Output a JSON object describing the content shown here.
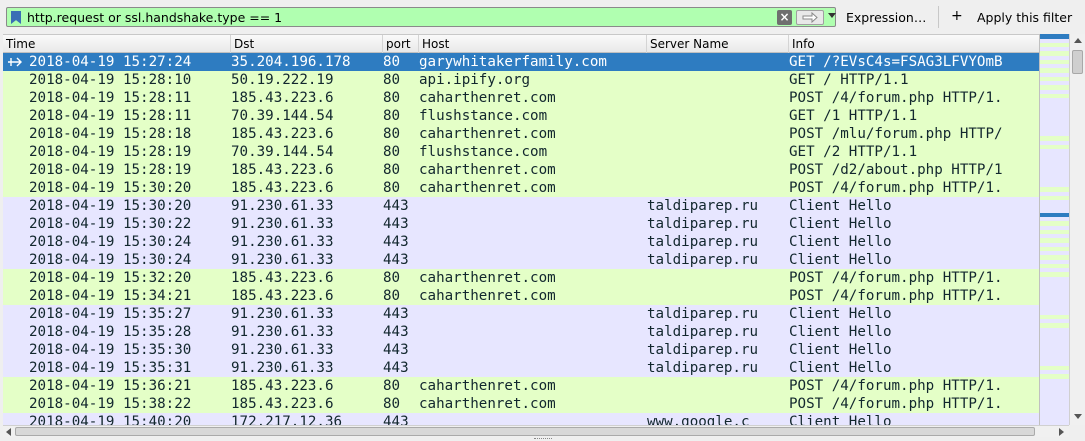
{
  "filter": {
    "value": "http.request or ssl.handshake.type == 1",
    "expression_label": "Expression…",
    "plus_label": "+",
    "apply_label": "Apply this filter"
  },
  "columns": [
    {
      "label": "Time"
    },
    {
      "label": "Dst"
    },
    {
      "label": "port"
    },
    {
      "label": "Host"
    },
    {
      "label": "Server Name"
    },
    {
      "label": "Info"
    }
  ],
  "colors": {
    "http_row": "#e4ffc7",
    "tls_row": "#e7e6ff",
    "selected_row": "#2e7cc1",
    "filter_valid": "#b0ffb0"
  },
  "packets": [
    {
      "time": "2018-04-19 15:27:24",
      "dst": "35.204.196.178",
      "port": "80",
      "host": "garywhitakerfamily.com",
      "sni": "",
      "info": "GET /?EVsC4s=FSAG3LFVYOmB",
      "type": "http",
      "selected": true
    },
    {
      "time": "2018-04-19 15:28:10",
      "dst": "50.19.222.19",
      "port": "80",
      "host": "api.ipify.org",
      "sni": "",
      "info": "GET / HTTP/1.1",
      "type": "http"
    },
    {
      "time": "2018-04-19 15:28:11",
      "dst": "185.43.223.6",
      "port": "80",
      "host": "caharthenret.com",
      "sni": "",
      "info": "POST /4/forum.php HTTP/1.",
      "type": "http"
    },
    {
      "time": "2018-04-19 15:28:11",
      "dst": "70.39.144.54",
      "port": "80",
      "host": "flushstance.com",
      "sni": "",
      "info": "GET /1 HTTP/1.1",
      "type": "http"
    },
    {
      "time": "2018-04-19 15:28:18",
      "dst": "185.43.223.6",
      "port": "80",
      "host": "caharthenret.com",
      "sni": "",
      "info": "POST /mlu/forum.php HTTP/",
      "type": "http"
    },
    {
      "time": "2018-04-19 15:28:19",
      "dst": "70.39.144.54",
      "port": "80",
      "host": "flushstance.com",
      "sni": "",
      "info": "GET /2 HTTP/1.1",
      "type": "http"
    },
    {
      "time": "2018-04-19 15:28:19",
      "dst": "185.43.223.6",
      "port": "80",
      "host": "caharthenret.com",
      "sni": "",
      "info": "POST /d2/about.php HTTP/1",
      "type": "http"
    },
    {
      "time": "2018-04-19 15:30:20",
      "dst": "185.43.223.6",
      "port": "80",
      "host": "caharthenret.com",
      "sni": "",
      "info": "POST /4/forum.php HTTP/1.",
      "type": "http"
    },
    {
      "time": "2018-04-19 15:30:20",
      "dst": "91.230.61.33",
      "port": "443",
      "host": "",
      "sni": "taldiparep.ru",
      "info": "Client Hello",
      "type": "tls"
    },
    {
      "time": "2018-04-19 15:30:22",
      "dst": "91.230.61.33",
      "port": "443",
      "host": "",
      "sni": "taldiparep.ru",
      "info": "Client Hello",
      "type": "tls"
    },
    {
      "time": "2018-04-19 15:30:24",
      "dst": "91.230.61.33",
      "port": "443",
      "host": "",
      "sni": "taldiparep.ru",
      "info": "Client Hello",
      "type": "tls"
    },
    {
      "time": "2018-04-19 15:30:24",
      "dst": "91.230.61.33",
      "port": "443",
      "host": "",
      "sni": "taldiparep.ru",
      "info": "Client Hello",
      "type": "tls"
    },
    {
      "time": "2018-04-19 15:32:20",
      "dst": "185.43.223.6",
      "port": "80",
      "host": "caharthenret.com",
      "sni": "",
      "info": "POST /4/forum.php HTTP/1.",
      "type": "http"
    },
    {
      "time": "2018-04-19 15:34:21",
      "dst": "185.43.223.6",
      "port": "80",
      "host": "caharthenret.com",
      "sni": "",
      "info": "POST /4/forum.php HTTP/1.",
      "type": "http"
    },
    {
      "time": "2018-04-19 15:35:27",
      "dst": "91.230.61.33",
      "port": "443",
      "host": "",
      "sni": "taldiparep.ru",
      "info": "Client Hello",
      "type": "tls"
    },
    {
      "time": "2018-04-19 15:35:28",
      "dst": "91.230.61.33",
      "port": "443",
      "host": "",
      "sni": "taldiparep.ru",
      "info": "Client Hello",
      "type": "tls"
    },
    {
      "time": "2018-04-19 15:35:30",
      "dst": "91.230.61.33",
      "port": "443",
      "host": "",
      "sni": "taldiparep.ru",
      "info": "Client Hello",
      "type": "tls"
    },
    {
      "time": "2018-04-19 15:35:31",
      "dst": "91.230.61.33",
      "port": "443",
      "host": "",
      "sni": "taldiparep.ru",
      "info": "Client Hello",
      "type": "tls"
    },
    {
      "time": "2018-04-19 15:36:21",
      "dst": "185.43.223.6",
      "port": "80",
      "host": "caharthenret.com",
      "sni": "",
      "info": "POST /4/forum.php HTTP/1.",
      "type": "http"
    },
    {
      "time": "2018-04-19 15:38:22",
      "dst": "185.43.223.6",
      "port": "80",
      "host": "caharthenret.com",
      "sni": "",
      "info": "POST /4/forum.php HTTP/1.",
      "type": "http"
    },
    {
      "time": "2018-04-19 15:40:20",
      "dst": "172.217.12.36",
      "port": "443",
      "host": "",
      "sni": "www.google.c",
      "info": "Client Hello",
      "type": "tls"
    }
  ]
}
